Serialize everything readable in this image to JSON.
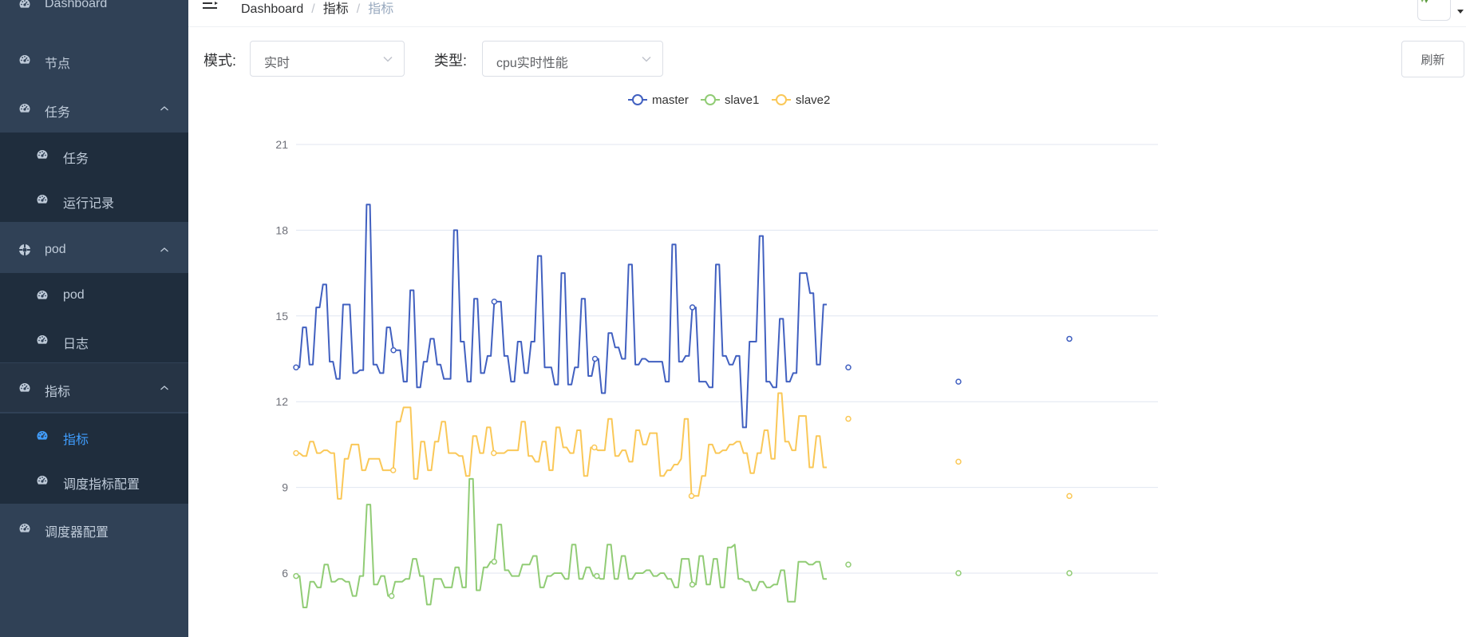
{
  "sidebar": {
    "items": [
      {
        "label": "Dashboard",
        "icon": "dashboard-icon",
        "level": 0
      },
      {
        "label": "节点",
        "icon": "dashboard-icon",
        "level": 0
      },
      {
        "label": "任务",
        "icon": "dashboard-icon",
        "level": 0,
        "expandable": true
      },
      {
        "label": "任务",
        "icon": "dashboard-icon",
        "level": 1
      },
      {
        "label": "运行记录",
        "icon": "dashboard-icon",
        "level": 1
      },
      {
        "label": "pod",
        "icon": "pod-icon",
        "level": 0,
        "expandable": true
      },
      {
        "label": "pod",
        "icon": "dashboard-icon",
        "level": 1
      },
      {
        "label": "日志",
        "icon": "dashboard-icon",
        "level": 1
      },
      {
        "label": "指标",
        "icon": "dashboard-icon",
        "level": 0,
        "expandable": true,
        "highlight": true
      },
      {
        "label": "指标",
        "icon": "dashboard-icon",
        "level": 1,
        "active": true
      },
      {
        "label": "调度指标配置",
        "icon": "dashboard-icon",
        "level": 1
      },
      {
        "label": "调度器配置",
        "icon": "dashboard-icon",
        "level": 0
      }
    ],
    "colors": {
      "background": "#304156",
      "submenu": "#1f2d3d",
      "text": "#bfcbd9",
      "active": "#409eff"
    }
  },
  "navbar": {
    "breadcrumb": [
      "Dashboard",
      "指标",
      "指标"
    ],
    "separator": "/"
  },
  "filters": {
    "mode_label": "模式:",
    "mode_value": "实时",
    "type_label": "类型:",
    "type_value": "cpu实时性能",
    "refresh_label": "刷新"
  },
  "chart_data": {
    "type": "line",
    "title": "",
    "xlabel": "",
    "ylabel": "",
    "ylim": [
      3,
      21
    ],
    "yticks": [
      6,
      9,
      12,
      15,
      18,
      21
    ],
    "grid": true,
    "legend": "top-center",
    "series": [
      {
        "name": "master",
        "color": "#4160c0",
        "values": [
          13.2,
          13.2,
          14.6,
          14.6,
          13.3,
          13.3,
          15.3,
          15.3,
          16.1,
          16.1,
          13.4,
          13.4,
          12.8,
          12.8,
          15.4,
          15.4,
          15.4,
          13.0,
          13.0,
          13.1,
          13.1,
          18.9,
          18.9,
          13.3,
          13.3,
          13.0,
          13.0,
          14.6,
          14.6,
          13.8,
          13.8,
          13.8,
          12.7,
          12.7,
          15.9,
          15.9,
          12.5,
          12.5,
          13.4,
          13.4,
          14.2,
          14.2,
          13.3,
          13.3,
          12.8,
          12.8,
          12.8,
          18.0,
          18.0,
          14.1,
          14.1,
          12.7,
          12.7,
          15.6,
          15.6,
          13.0,
          13.0,
          13.6,
          13.6,
          15.5,
          15.5,
          15.5,
          13.6,
          13.6,
          12.7,
          12.7,
          14.1,
          14.1,
          13.0,
          13.0,
          14.1,
          14.1,
          17.1,
          17.1,
          13.2,
          13.2,
          13.2,
          12.6,
          12.6,
          16.5,
          16.5,
          12.6,
          12.6,
          13.2,
          13.2,
          15.6,
          15.6,
          12.9,
          12.9,
          13.5,
          13.5,
          12.3,
          12.3,
          14.4,
          14.4,
          13.9,
          13.9,
          13.5,
          13.5,
          16.8,
          16.8,
          13.3,
          13.3,
          13.5,
          13.5,
          13.4,
          13.4,
          13.4,
          13.4,
          13.4,
          12.7,
          12.7,
          17.5,
          17.5,
          13.4,
          13.4,
          13.6,
          13.6,
          15.3,
          15.3,
          12.7,
          12.7,
          12.7,
          12.5,
          12.5,
          16.8,
          16.8,
          13.6,
          13.6,
          13.3,
          13.3,
          13.6,
          13.6,
          11.1,
          11.1,
          14.1,
          14.1,
          14.1,
          17.8,
          17.8,
          12.7,
          12.7,
          12.5,
          12.5,
          14.9,
          14.9,
          12.7,
          12.7,
          13.0,
          13.0,
          16.5,
          16.5,
          16.5,
          15.8,
          15.8,
          13.3,
          13.3,
          15.4,
          15.4
        ],
        "trailing_points": [
          {
            "x": 1,
            "y": 13.2
          },
          {
            "x": 2,
            "y": 12.7
          },
          {
            "x": 3,
            "y": 14.2
          }
        ]
      },
      {
        "name": "slave1",
        "color": "#91cc75",
        "values": [
          5.9,
          5.9,
          4.8,
          4.8,
          5.7,
          5.7,
          5.5,
          5.5,
          6.3,
          6.3,
          5.7,
          5.7,
          5.8,
          5.8,
          5.7,
          5.7,
          5.2,
          5.2,
          5.9,
          5.9,
          8.4,
          8.4,
          5.6,
          5.6,
          5.9,
          5.9,
          5.2,
          5.2,
          5.7,
          5.7,
          5.7,
          5.8,
          5.8,
          6.5,
          6.5,
          5.9,
          5.9,
          4.9,
          4.9,
          5.8,
          5.8,
          5.8,
          5.5,
          5.5,
          5.5,
          6.2,
          6.2,
          5.5,
          5.5,
          9.3,
          9.3,
          5.4,
          5.4,
          6.2,
          6.2,
          6.4,
          6.4,
          7.7,
          7.7,
          6.1,
          6.1,
          5.9,
          5.9,
          5.9,
          6.3,
          6.3,
          6.3,
          6.6,
          6.6,
          5.5,
          5.5,
          5.9,
          5.9,
          6.0,
          6.0,
          6.0,
          5.8,
          5.8,
          7.0,
          7.0,
          5.8,
          5.8,
          6.2,
          6.2,
          5.9,
          5.9,
          5.8,
          5.8,
          7.0,
          7.0,
          5.8,
          5.8,
          6.6,
          6.6,
          5.8,
          5.8,
          6.0,
          6.0,
          6.0,
          6.1,
          6.1,
          5.9,
          5.9,
          6.0,
          6.0,
          5.8,
          5.8,
          5.5,
          5.5,
          6.5,
          6.5,
          6.5,
          5.6,
          5.6,
          6.6,
          6.6,
          5.6,
          5.6,
          6.5,
          6.5,
          5.5,
          5.5,
          6.9,
          6.9,
          7.0,
          5.8,
          5.8,
          5.7,
          5.7,
          5.4,
          5.4,
          5.7,
          5.7,
          5.5,
          5.5,
          5.6,
          5.6,
          6.1,
          6.1,
          5.0,
          5.0,
          5.0,
          6.4,
          6.4,
          6.4,
          6.3,
          6.3,
          6.4,
          6.4,
          5.8,
          5.8
        ],
        "trailing_points": [
          {
            "x": 1,
            "y": 6.3
          },
          {
            "x": 2,
            "y": 6.0
          },
          {
            "x": 3,
            "y": 6.0
          }
        ]
      },
      {
        "name": "slave2",
        "color": "#fac858",
        "values": [
          10.2,
          10.2,
          10.1,
          10.1,
          10.6,
          10.6,
          10.2,
          10.2,
          10.3,
          10.3,
          10.2,
          10.2,
          8.6,
          8.6,
          10.0,
          10.0,
          10.5,
          10.5,
          10.5,
          9.6,
          9.6,
          10.0,
          10.0,
          10.0,
          10.0,
          9.6,
          9.6,
          9.6,
          9.6,
          11.3,
          11.3,
          11.8,
          11.8,
          11.8,
          9.3,
          9.3,
          10.6,
          10.6,
          9.6,
          9.6,
          10.6,
          10.6,
          11.3,
          11.3,
          10.2,
          10.2,
          10.2,
          10.1,
          10.1,
          9.4,
          9.4,
          10.8,
          10.8,
          10.2,
          10.2,
          11.1,
          11.1,
          10.2,
          10.2,
          10.2,
          10.2,
          10.3,
          10.3,
          10.3,
          10.3,
          11.3,
          11.3,
          10.1,
          10.1,
          9.9,
          9.9,
          10.6,
          10.6,
          9.6,
          9.6,
          11.1,
          11.1,
          10.4,
          10.4,
          10.2,
          10.2,
          11.0,
          11.0,
          9.4,
          9.4,
          10.4,
          10.4,
          10.3,
          10.3,
          10.3,
          11.4,
          11.4,
          10.1,
          10.1,
          10.3,
          10.3,
          9.9,
          9.9,
          11.0,
          11.0,
          10.5,
          10.5,
          10.9,
          10.9,
          10.9,
          9.4,
          9.4,
          9.6,
          9.6,
          9.8,
          9.8,
          10.0,
          11.4,
          11.4,
          8.7,
          8.7,
          8.7,
          9.4,
          9.4,
          10.5,
          10.5,
          10.2,
          10.2,
          10.3,
          10.3,
          10.5,
          10.5,
          10.6,
          10.6,
          10.2,
          10.2,
          9.5,
          9.5,
          10.2,
          10.2,
          11.0,
          11.0,
          10.0,
          10.0,
          12.3,
          12.3,
          10.6,
          10.6,
          10.3,
          10.3,
          11.5,
          11.5,
          11.5,
          9.7,
          9.7,
          10.8,
          10.8,
          9.7,
          9.7
        ],
        "trailing_points": [
          {
            "x": 1,
            "y": 11.4
          },
          {
            "x": 2,
            "y": 9.9
          },
          {
            "x": 3,
            "y": 8.7
          }
        ]
      }
    ]
  }
}
